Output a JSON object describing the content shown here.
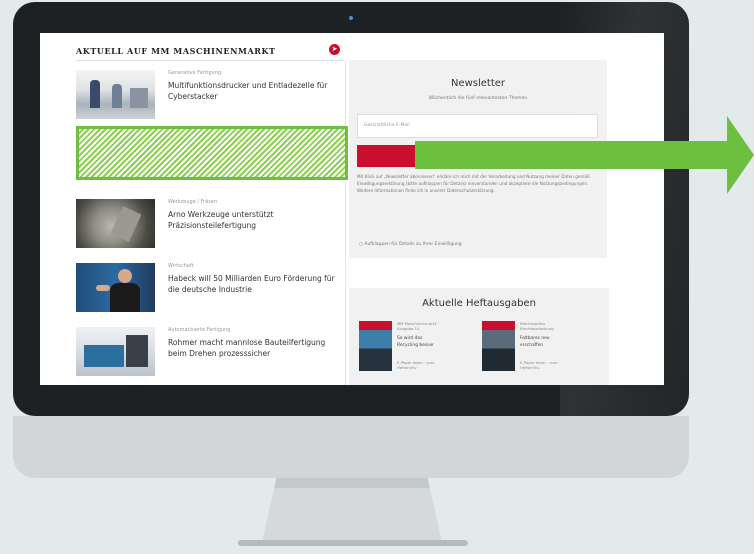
{
  "colors": {
    "accent_red": "#c8102e",
    "highlight_green": "#6dbf3f",
    "background": "#e3eaea"
  },
  "left": {
    "section_title": "AKTUELL AUF MM MASCHINENMARKT",
    "articles": [
      {
        "category": "Generative Fertigung",
        "title": "Multifunktionsdrucker und Entladezelle für Cyberstacker"
      },
      {
        "category": "Werkzeuge / Fräsen",
        "title": "Arno Werkzeuge unterstützt Präzisionsteilefertigung"
      },
      {
        "category": "Wirtschaft",
        "title": "Habeck will 50 Milliarden Euro Förderung für die deutsche Industrie"
      },
      {
        "category": "Automatisierte Fertigung",
        "title": "Rohmer macht mannlose Bauteilfertigung beim Drehen prozesssicher"
      }
    ]
  },
  "newsletter": {
    "title": "Newsletter",
    "subtitle": "Wöchentlich die fünf relevantesten Themen",
    "input_placeholder": "Geschäftliche E-Mail",
    "legal_text": "Mit Klick auf „Newsletter abonnieren“ erkläre ich mich mit der Verarbeitung und Nutzung meiner Daten gemäß Einwilligungserklärung (bitte aufklappen für Details) einverstanden und akzeptiere die Nutzungsbedingungen. Weitere Informationen finde ich in unserer Datenschutzerklärung.",
    "checkbox_label": "Aufklappen für Details zu Ihrer Einwilligung"
  },
  "issues": {
    "title": "Aktuelle Heftausgaben",
    "items": [
      {
        "meta": "MM Maschinenmarkt · Ausgabe 14",
        "title": "So wird das Recycling besser",
        "link": "E-Paper lesen · zum Heftarchiv"
      },
      {
        "meta": "Blechexpress Blechbearbeitung",
        "title": "Faltbares neu erschaffen",
        "link": "E-Paper lesen · zum Heftarchiv"
      }
    ]
  }
}
